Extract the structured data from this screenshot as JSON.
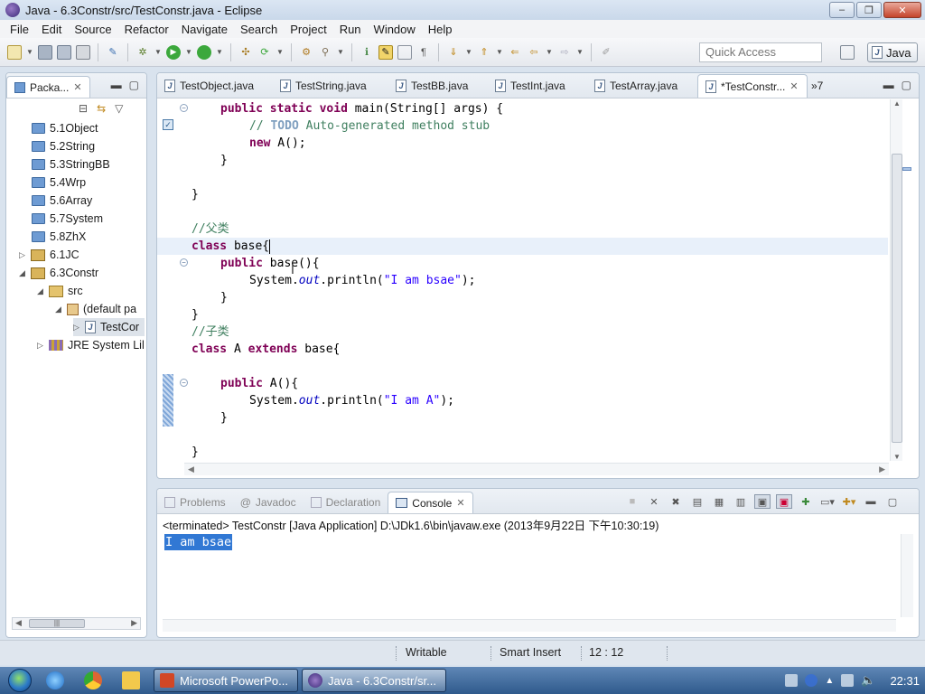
{
  "window": {
    "title": "Java - 6.3Constr/src/TestConstr.java - Eclipse",
    "controls": [
      "‒",
      "❐",
      "✕"
    ]
  },
  "menu": [
    "File",
    "Edit",
    "Source",
    "Refactor",
    "Navigate",
    "Search",
    "Project",
    "Run",
    "Window",
    "Help"
  ],
  "toolbar": {
    "quick_access_placeholder": "Quick Access",
    "perspective": "Java"
  },
  "package_explorer": {
    "tab_label": "Packa...",
    "items": [
      {
        "label": "5.1Object",
        "type": "folder"
      },
      {
        "label": "5.2String",
        "type": "folder"
      },
      {
        "label": "5.3StringBB",
        "type": "folder"
      },
      {
        "label": "5.4Wrp",
        "type": "folder"
      },
      {
        "label": "5.6Array",
        "type": "folder"
      },
      {
        "label": "5.7System",
        "type": "folder"
      },
      {
        "label": "5.8ZhX",
        "type": "folder"
      },
      {
        "label": "6.1JC",
        "type": "project",
        "expanded": false
      },
      {
        "label": "6.3Constr",
        "type": "project",
        "expanded": true
      },
      {
        "label": "src",
        "type": "source",
        "expanded": true
      },
      {
        "label": "(default pa",
        "type": "package",
        "expanded": true
      },
      {
        "label": "TestCor",
        "type": "java-file"
      },
      {
        "label": "JRE System Lil",
        "type": "library",
        "expanded": false
      }
    ]
  },
  "editor": {
    "tabs": [
      "TestObject.java",
      "TestString.java",
      "TestBB.java",
      "TestInt.java",
      "TestArray.java",
      "*TestConstr..."
    ],
    "active_tab": 5,
    "overflow_label": "»7",
    "lines": {
      "l1_a": "public",
      "l1_b": "static",
      "l1_c": "void",
      "l1_d": " main(String[] args) {",
      "l2_a": "// ",
      "l2_b": "TODO",
      "l2_c": " Auto-generated method stub",
      "l3_a": "new",
      "l3_b": " A();",
      "l4": "}",
      "l5": "}",
      "l6": "//父类",
      "l7_a": "class",
      "l7_b": " base{",
      "l8_a": "public",
      "l8_b": " base(){",
      "l9_a": "System.",
      "l9_b": "out",
      "l9_c": ".println(",
      "l9_d": "\"I am bsae\"",
      "l9_e": ");",
      "l10": "}",
      "l11": "}",
      "l12": "//子类",
      "l13_a": "class",
      "l13_b": " A ",
      "l13_c": "extends",
      "l13_d": " base{",
      "l14_a": "public",
      "l14_b": " A(){",
      "l15_a": "System.",
      "l15_b": "out",
      "l15_c": ".println(",
      "l15_d": "\"I am A\"",
      "l15_e": ");",
      "l16": "}",
      "l17": "}"
    }
  },
  "console": {
    "tabs": [
      "Problems",
      "Javadoc",
      "Declaration",
      "Console"
    ],
    "active_tab": 3,
    "status": "<terminated> TestConstr [Java Application] D:\\JDk1.6\\bin\\javaw.exe (2013年9月22日 下午10:30:19)",
    "output": "I am bsae"
  },
  "statusbar": {
    "writable": "Writable",
    "insert_mode": "Smart Insert",
    "position": "12 : 12"
  },
  "taskbar": {
    "windows": [
      "Microsoft PowerPo...",
      "Java - 6.3Constr/sr..."
    ],
    "clock": "22:31"
  },
  "colors": {
    "keyword": "#7f0055",
    "comment": "#3f7f5f",
    "string": "#2a00ff",
    "static_field": "#0000c0",
    "selection": "#3178d4"
  }
}
